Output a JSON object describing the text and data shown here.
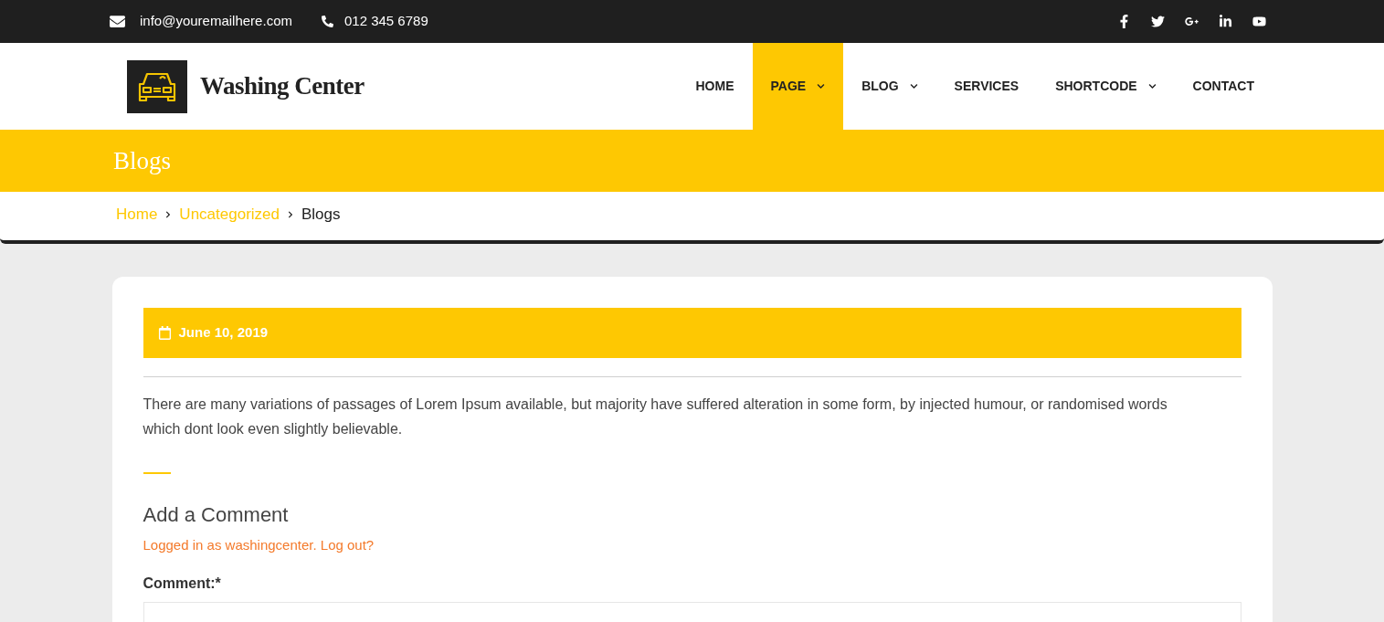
{
  "topbar": {
    "email": "info@youremailhere.com",
    "phone": "012 345 6789",
    "social": [
      {
        "kind": "facebook"
      },
      {
        "kind": "twitter"
      },
      {
        "kind": "googleplus"
      },
      {
        "kind": "linkedin"
      },
      {
        "kind": "youtube"
      }
    ]
  },
  "header": {
    "brand": "Washing Center",
    "nav": [
      {
        "label": "HOME",
        "selected": false,
        "dropdown": false
      },
      {
        "label": "PAGE",
        "selected": true,
        "dropdown": true
      },
      {
        "label": "BLOG",
        "selected": false,
        "dropdown": true
      },
      {
        "label": "SERVICES",
        "selected": false,
        "dropdown": false
      },
      {
        "label": "SHORTCODE",
        "selected": false,
        "dropdown": true
      },
      {
        "label": "CONTACT",
        "selected": false,
        "dropdown": false
      }
    ]
  },
  "banner": {
    "title": "Blogs"
  },
  "breadcrumb": [
    {
      "label": "Home",
      "link": true
    },
    {
      "label": "Uncategorized",
      "link": true
    },
    {
      "label": "Blogs",
      "link": false
    }
  ],
  "post": {
    "date": "June 10, 2019",
    "body": "There are many variations of passages of Lorem Ipsum available, but majority have suffered alteration in some form, by injected humour, or randomised words which dont look even slightly believable."
  },
  "comment_form": {
    "title": "Add a Comment",
    "logged_in_link": "Logged in as washingcenter",
    "separator": ".",
    "logout_link": "Log out?",
    "field_label": "Comment:*"
  }
}
